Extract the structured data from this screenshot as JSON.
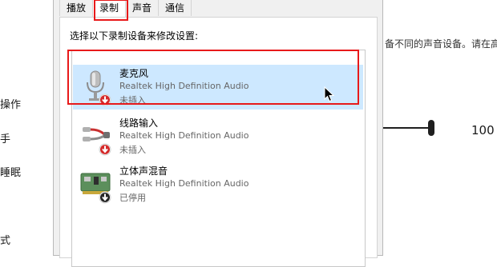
{
  "sidebar": {
    "items": [
      {
        "label": "操作"
      },
      {
        "label": "手"
      },
      {
        "label": "睡眠"
      },
      {
        "label": "式"
      }
    ]
  },
  "background": {
    "description_text": "备不同的声音设备。请在高",
    "slider_value": "100"
  },
  "dialog": {
    "tabs": [
      {
        "label": "播放"
      },
      {
        "label": "录制"
      },
      {
        "label": "声音"
      },
      {
        "label": "通信"
      }
    ],
    "active_tab": "录制",
    "instruction": "选择以下录制设备来修改设置:",
    "devices": [
      {
        "name": "麦克风",
        "driver": "Realtek High Definition Audio",
        "status": "未插入",
        "icon": "microphone-icon",
        "badge": "unplugged-badge"
      },
      {
        "name": "线路输入",
        "driver": "Realtek High Definition Audio",
        "status": "未插入",
        "icon": "line-in-icon",
        "badge": "unplugged-badge"
      },
      {
        "name": "立体声混音",
        "driver": "Realtek High Definition Audio",
        "status": "已停用",
        "icon": "stereo-mix-icon",
        "badge": "disabled-badge"
      }
    ]
  },
  "colors": {
    "highlight": "#e8191a",
    "selection": "#cde8ff"
  }
}
